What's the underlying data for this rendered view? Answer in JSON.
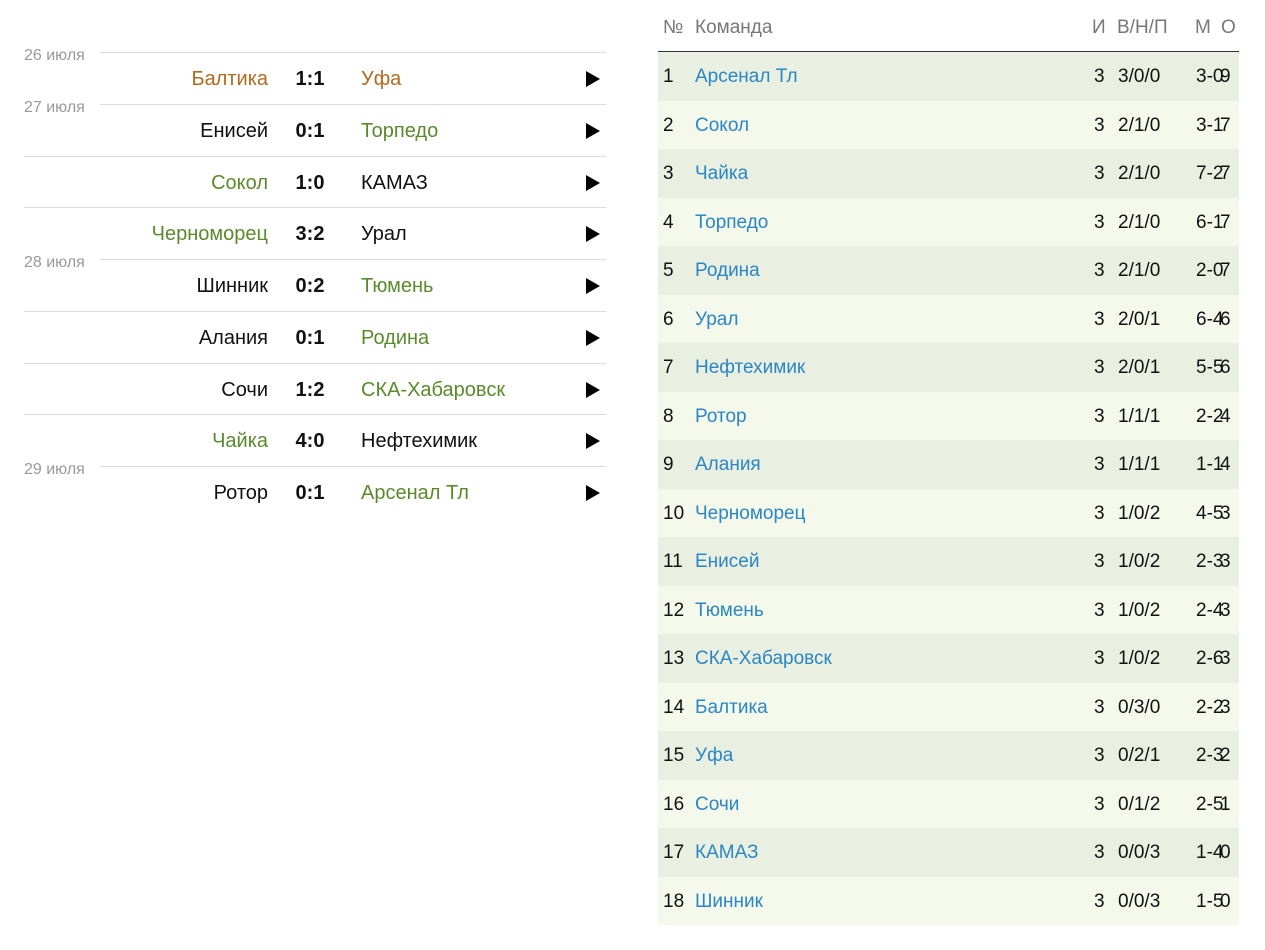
{
  "matches": {
    "dates": [
      "26 июля",
      "27 июля",
      "28 июля",
      "29 июля"
    ],
    "games": [
      {
        "home": "Балтика",
        "score": "1:1",
        "away": "Уфа",
        "result": "draw"
      },
      {
        "home": "Енисей",
        "score": "0:1",
        "away": "Торпедо",
        "result": "away"
      },
      {
        "home": "Сокол",
        "score": "1:0",
        "away": "КАМАЗ",
        "result": "home"
      },
      {
        "home": "Черноморец",
        "score": "3:2",
        "away": "Урал",
        "result": "home"
      },
      {
        "home": "Шинник",
        "score": "0:2",
        "away": "Тюмень",
        "result": "away"
      },
      {
        "home": "Алания",
        "score": "0:1",
        "away": "Родина",
        "result": "away"
      },
      {
        "home": "Сочи",
        "score": "1:2",
        "away": "СКА-Хабаровск",
        "result": "away"
      },
      {
        "home": "Чайка",
        "score": "4:0",
        "away": "Нефтехимик",
        "result": "home"
      },
      {
        "home": "Ротор",
        "score": "0:1",
        "away": "Арсенал Тл",
        "result": "away"
      }
    ],
    "play_icon": "play-triangle-icon"
  },
  "standings": {
    "headers": {
      "num": "№",
      "team": "Команда",
      "games": "И",
      "wdl": "В/Н/П",
      "goals": "М",
      "points": "О"
    },
    "rows": [
      {
        "num": "1",
        "team": "Арсенал Тл",
        "games": "3",
        "wdl": "3/0/0",
        "goals": "3-0",
        "points": "9"
      },
      {
        "num": "2",
        "team": "Сокол",
        "games": "3",
        "wdl": "2/1/0",
        "goals": "3-1",
        "points": "7"
      },
      {
        "num": "3",
        "team": "Чайка",
        "games": "3",
        "wdl": "2/1/0",
        "goals": "7-2",
        "points": "7"
      },
      {
        "num": "4",
        "team": "Торпедо",
        "games": "3",
        "wdl": "2/1/0",
        "goals": "6-1",
        "points": "7"
      },
      {
        "num": "5",
        "team": "Родина",
        "games": "3",
        "wdl": "2/1/0",
        "goals": "2-0",
        "points": "7"
      },
      {
        "num": "6",
        "team": "Урал",
        "games": "3",
        "wdl": "2/0/1",
        "goals": "6-4",
        "points": "6"
      },
      {
        "num": "7",
        "team": "Нефтехимик",
        "games": "3",
        "wdl": "2/0/1",
        "goals": "5-5",
        "points": "6"
      },
      {
        "num": "8",
        "team": "Ротор",
        "games": "3",
        "wdl": "1/1/1",
        "goals": "2-2",
        "points": "4"
      },
      {
        "num": "9",
        "team": "Алания",
        "games": "3",
        "wdl": "1/1/1",
        "goals": "1-1",
        "points": "4"
      },
      {
        "num": "10",
        "team": "Черноморец",
        "games": "3",
        "wdl": "1/0/2",
        "goals": "4-5",
        "points": "3"
      },
      {
        "num": "11",
        "team": "Енисей",
        "games": "3",
        "wdl": "1/0/2",
        "goals": "2-3",
        "points": "3"
      },
      {
        "num": "12",
        "team": "Тюмень",
        "games": "3",
        "wdl": "1/0/2",
        "goals": "2-4",
        "points": "3"
      },
      {
        "num": "13",
        "team": "СКА-Хабаровск",
        "games": "3",
        "wdl": "1/0/2",
        "goals": "2-6",
        "points": "3"
      },
      {
        "num": "14",
        "team": "Балтика",
        "games": "3",
        "wdl": "0/3/0",
        "goals": "2-2",
        "points": "3"
      },
      {
        "num": "15",
        "team": "Уфа",
        "games": "3",
        "wdl": "0/2/1",
        "goals": "2-3",
        "points": "2"
      },
      {
        "num": "16",
        "team": "Сочи",
        "games": "3",
        "wdl": "0/1/2",
        "goals": "2-5",
        "points": "1"
      },
      {
        "num": "17",
        "team": "КАМАЗ",
        "games": "3",
        "wdl": "0/0/3",
        "goals": "1-4",
        "points": "0"
      },
      {
        "num": "18",
        "team": "Шинник",
        "games": "3",
        "wdl": "0/0/3",
        "goals": "1-5",
        "points": "0"
      }
    ]
  },
  "colors": {
    "draw": "#b06a1e",
    "win": "#5b8a2d",
    "link": "#2b86c5",
    "row_odd": "#eaf0e1",
    "row_even": "#f4f9ec"
  }
}
